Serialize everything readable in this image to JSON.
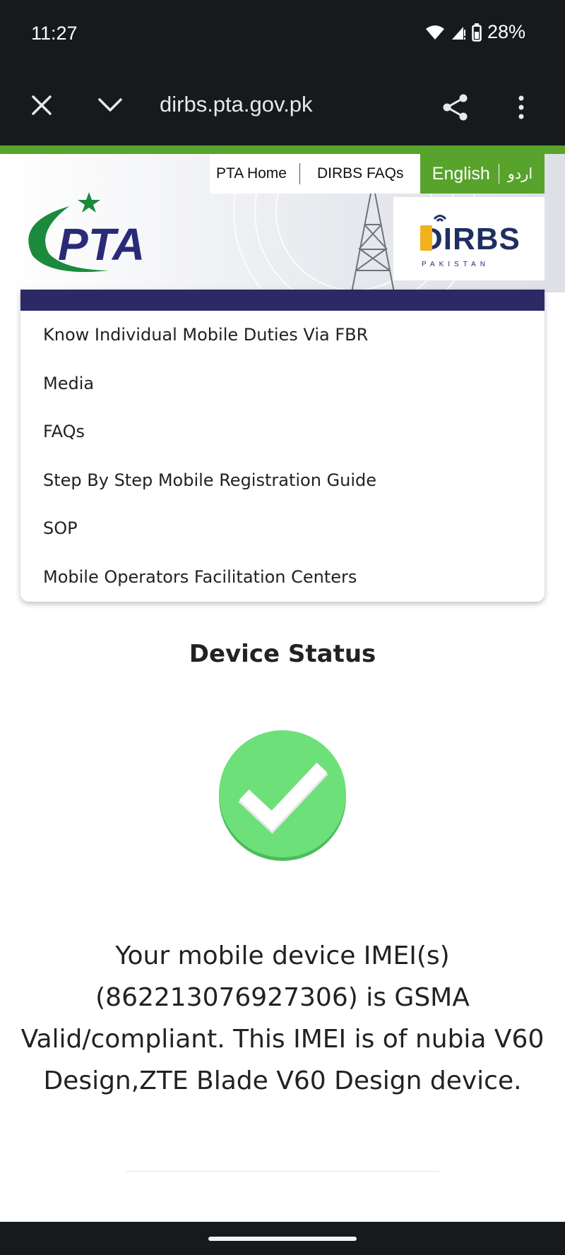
{
  "status_bar": {
    "time": "11:27",
    "battery": "28%"
  },
  "browser": {
    "url": "dirbs.pta.gov.pk"
  },
  "header": {
    "links": [
      "PTA Home",
      "DIRBS FAQs"
    ],
    "lang_english": "English",
    "lang_urdu": "اردو",
    "pta_logo_text": "PTA",
    "dirbs_logo_text": "DIRBS",
    "dirbs_logo_sub": "PAKISTAN"
  },
  "menu": {
    "items": [
      "Know Individual Mobile Duties Via FBR",
      "Media",
      "FAQs",
      "Step By Step Mobile Registration Guide",
      "SOP",
      "Mobile Operators Facilitation Centers"
    ]
  },
  "device_status": {
    "title": "Device Status",
    "message": "Your mobile device IMEI(s) (862213076927306) is GSMA Valid/compliant. This IMEI is of nubia V60 Design,ZTE Blade V60 Design device."
  },
  "colors": {
    "accent_green": "#57a32b",
    "nav_purple": "#2b2a66",
    "check_green": "#6ee07a"
  }
}
